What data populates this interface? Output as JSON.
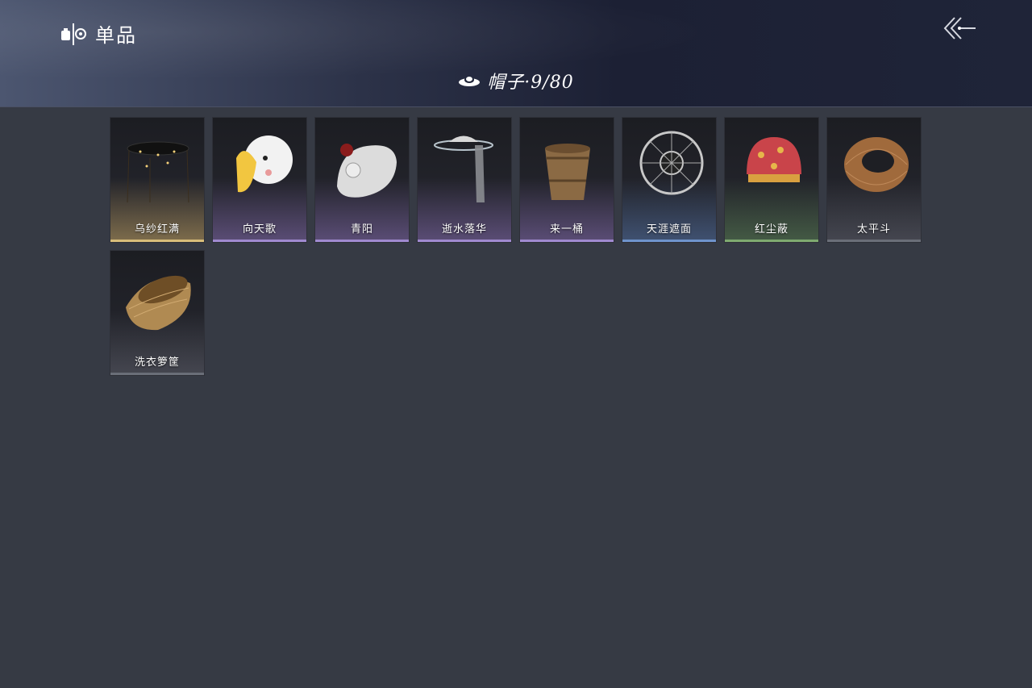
{
  "header": {
    "title": "单品",
    "title_icon": "wardrobe-icon",
    "back_icon": "back-arrow-icon"
  },
  "category": {
    "icon": "hat-icon",
    "label": "帽子·9/80"
  },
  "items": [
    {
      "name": "乌纱红满",
      "rarity": "gold",
      "icon": "black-gauze-hat-icon"
    },
    {
      "name": "向天歌",
      "rarity": "purple",
      "icon": "goose-hood-hat-icon"
    },
    {
      "name": "青阳",
      "rarity": "purple",
      "icon": "white-rabbit-hat-icon"
    },
    {
      "name": "逝水落华",
      "rarity": "purple",
      "icon": "veiled-hat-icon"
    },
    {
      "name": "来一桶",
      "rarity": "purple",
      "icon": "wooden-bucket-hat-icon"
    },
    {
      "name": "天涯遮面",
      "rarity": "blue",
      "icon": "frame-hat-icon"
    },
    {
      "name": "红尘蔽",
      "rarity": "green",
      "icon": "red-cap-icon"
    },
    {
      "name": "太平斗",
      "rarity": "plain",
      "icon": "bamboo-hat-icon"
    },
    {
      "name": "洗衣箩筐",
      "rarity": "plain",
      "icon": "laundry-basket-icon"
    }
  ],
  "colors": {
    "background": "#363a44",
    "gold": "#d8bd7a",
    "purple": "#a08ad0",
    "blue": "#6f93cc",
    "green": "#7faa70"
  }
}
